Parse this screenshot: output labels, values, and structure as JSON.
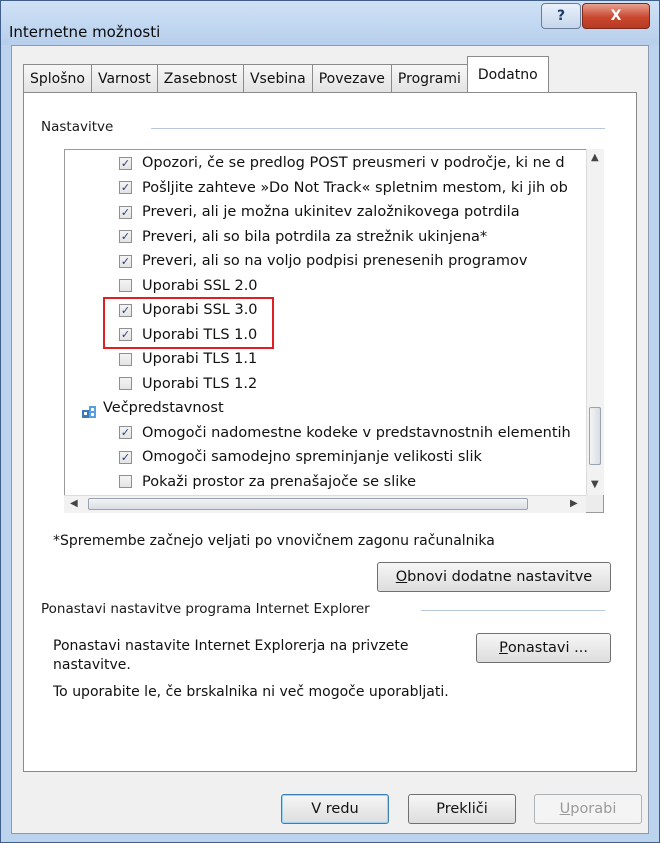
{
  "window": {
    "title": "Internetne možnosti",
    "help_glyph": "?",
    "close_glyph": "X"
  },
  "tabs": [
    {
      "label": "Splošno",
      "active": false
    },
    {
      "label": "Varnost",
      "active": false
    },
    {
      "label": "Zasebnost",
      "active": false
    },
    {
      "label": "Vsebina",
      "active": false
    },
    {
      "label": "Povezave",
      "active": false
    },
    {
      "label": "Programi",
      "active": false
    },
    {
      "label": "Dodatno",
      "active": true
    }
  ],
  "settings": {
    "group_label": "Nastavitve",
    "rows": [
      {
        "type": "checkbox",
        "checked": true,
        "label": "Opozori, če se predlog POST preusmeri v področje, ki ne d"
      },
      {
        "type": "checkbox",
        "checked": true,
        "label": "Pošljite zahteve »Do Not Track« spletnim mestom, ki jih ob"
      },
      {
        "type": "checkbox",
        "checked": true,
        "label": "Preveri, ali je možna ukinitev založnikovega potrdila"
      },
      {
        "type": "checkbox",
        "checked": true,
        "label": "Preveri, ali so bila potrdila za strežnik ukinjena*"
      },
      {
        "type": "checkbox",
        "checked": true,
        "label": "Preveri, ali so na voljo podpisi prenesenih programov"
      },
      {
        "type": "checkbox",
        "checked": false,
        "label": "Uporabi SSL 2.0"
      },
      {
        "type": "checkbox",
        "checked": true,
        "label": "Uporabi SSL 3.0"
      },
      {
        "type": "checkbox",
        "checked": true,
        "label": "Uporabi TLS 1.0"
      },
      {
        "type": "checkbox",
        "checked": false,
        "label": "Uporabi TLS 1.1"
      },
      {
        "type": "checkbox",
        "checked": false,
        "label": "Uporabi TLS 1.2"
      },
      {
        "type": "category",
        "label": "Večpredstavnost"
      },
      {
        "type": "checkbox",
        "checked": true,
        "label": "Omogoči nadomestne kodeke v predstavnostnih elementih"
      },
      {
        "type": "checkbox",
        "checked": true,
        "label": "Omogoči samodejno spreminjanje velikosti slik"
      },
      {
        "type": "checkbox",
        "checked": false,
        "label": "Pokaži prostor za prenašajoče se slike"
      }
    ],
    "restart_note": "*Spremembe začnejo veljati po vnovičnem zagonu računalnika",
    "restore_button": {
      "prefix": "O",
      "rest": "bnovi dodatne nastavitve"
    }
  },
  "reset": {
    "group_label": "Ponastavi nastavitve programa Internet Explorer",
    "description": "Ponastavi nastavite Internet Explorerja na privzete nastavitve.",
    "hint": "To uporabite le, če brskalnika ni več mogoče uporabljati.",
    "button": {
      "prefix": "P",
      "rest": "onastavi ..."
    }
  },
  "footer": {
    "ok_label": "V redu",
    "cancel_label": "Prekliči",
    "apply": {
      "prefix": "U",
      "rest": "porabi"
    }
  },
  "colors": {
    "highlight": "#e02020",
    "check": "#2a3e7a"
  }
}
